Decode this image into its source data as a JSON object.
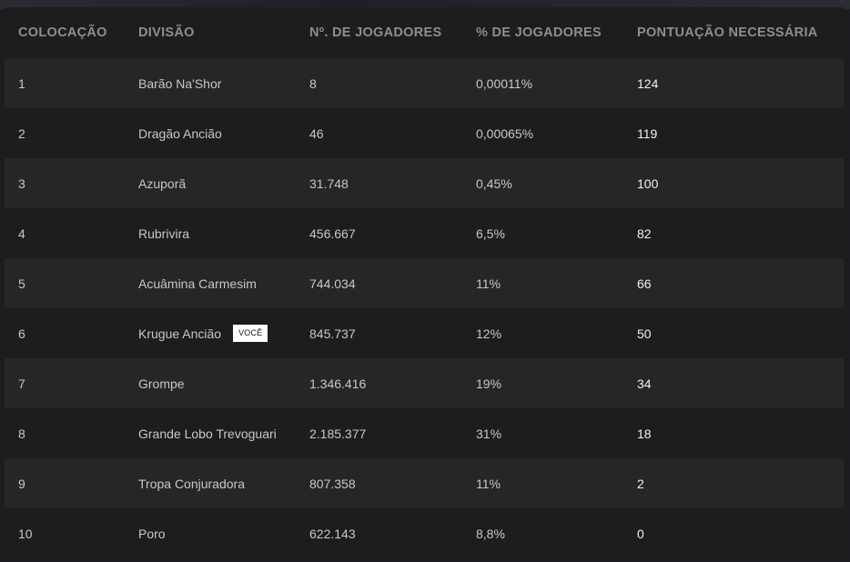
{
  "table": {
    "headers": [
      "COLOCAÇÃO",
      "DIVISÃO",
      "Nº. DE JOGADORES",
      "% DE JOGADORES",
      "PONTUAÇÃO NECESSÁRIA"
    ],
    "you_label": "VOCÊ",
    "rows": [
      {
        "rank": "1",
        "division": "Barão Na'Shor",
        "players": "8",
        "percent": "0,00011%",
        "score": "124"
      },
      {
        "rank": "2",
        "division": "Dragão Ancião",
        "players": "46",
        "percent": "0,00065%",
        "score": "119"
      },
      {
        "rank": "3",
        "division": "Azuporã",
        "players": "31.748",
        "percent": "0,45%",
        "score": "100"
      },
      {
        "rank": "4",
        "division": "Rubrivira",
        "players": "456.667",
        "percent": "6,5%",
        "score": "82"
      },
      {
        "rank": "5",
        "division": "Acuâmina Carmesim",
        "players": "744.034",
        "percent": "11%",
        "score": "66"
      },
      {
        "rank": "6",
        "division": "Krugue Ancião",
        "players": "845.737",
        "percent": "12%",
        "score": "50"
      },
      {
        "rank": "7",
        "division": "Grompe",
        "players": "1.346.416",
        "percent": "19%",
        "score": "34"
      },
      {
        "rank": "8",
        "division": "Grande Lobo Trevoguari",
        "players": "2.185.377",
        "percent": "31%",
        "score": "18"
      },
      {
        "rank": "9",
        "division": "Tropa Conjuradora",
        "players": "807.358",
        "percent": "11%",
        "score": "2"
      },
      {
        "rank": "10",
        "division": "Poro",
        "players": "622.143",
        "percent": "8,8%",
        "score": "0"
      }
    ]
  }
}
